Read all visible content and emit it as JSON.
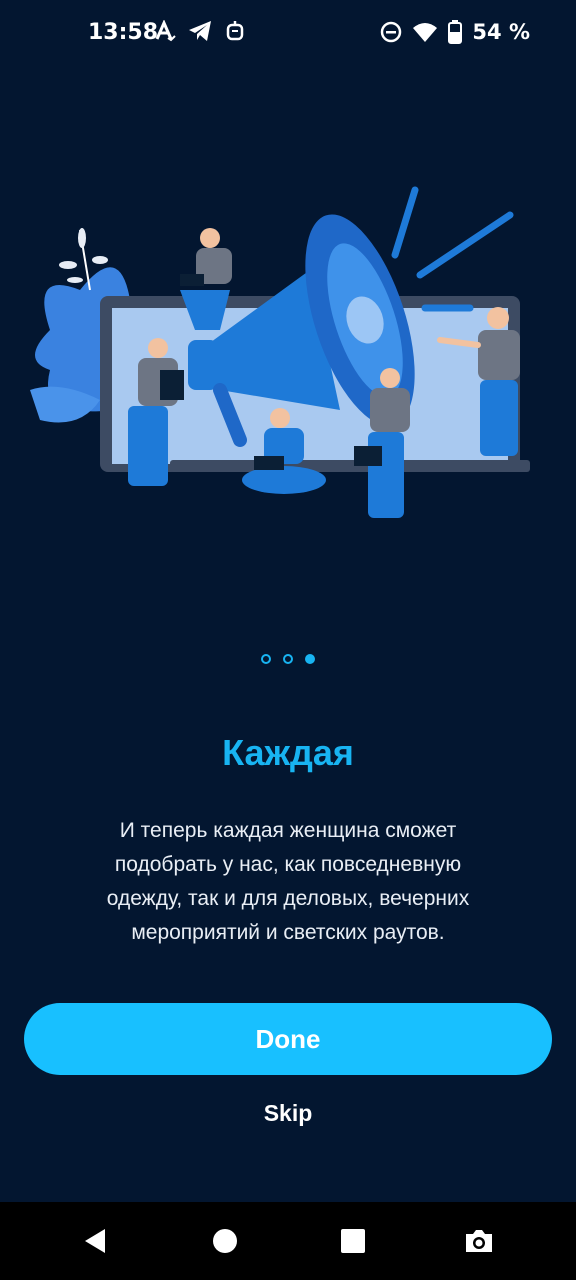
{
  "status_bar": {
    "time": "13:58",
    "left_icons": [
      "a-accessibility-icon",
      "telegram-icon",
      "bot-icon"
    ],
    "right_icons": [
      "do-not-disturb-icon",
      "wifi-icon",
      "battery-icon"
    ],
    "battery": "54 %"
  },
  "onboarding": {
    "page_count": 3,
    "active_page": 3,
    "title": "Каждая",
    "description": "И теперь каждая женщина сможет подобрать у нас, как повседневную одежду, так и для деловых, вечерних мероприятий и светских раутов.",
    "done_label": "Done",
    "skip_label": "Skip"
  },
  "navigation_bar": {
    "buttons": [
      "back-icon",
      "home-icon",
      "recents-icon",
      "screenshot-icon"
    ]
  },
  "colors": {
    "background": "#031630",
    "accent": "#18b4f2",
    "button": "#18c0ff"
  }
}
